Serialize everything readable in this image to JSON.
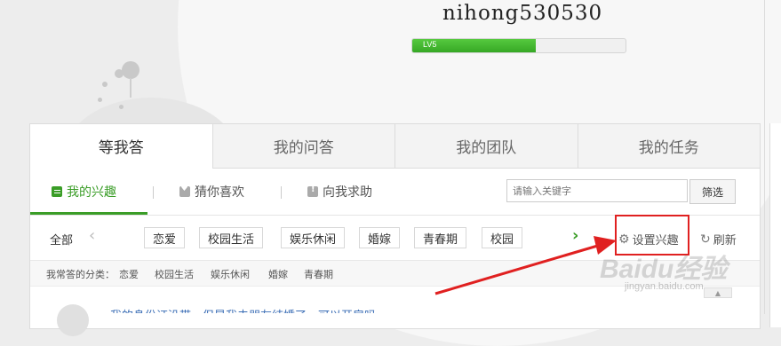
{
  "header": {
    "username": "nihong530530",
    "level_label": "LV5",
    "level_progress": 0.58
  },
  "main_tabs": [
    {
      "label": "等我答",
      "active": true
    },
    {
      "label": "我的问答",
      "active": false
    },
    {
      "label": "我的团队",
      "active": false
    },
    {
      "label": "我的任务",
      "active": false
    }
  ],
  "subnav": {
    "items": [
      {
        "label": "我的兴趣",
        "icon": "list-icon",
        "active": true
      },
      {
        "label": "猜你喜欢",
        "icon": "heart-icon",
        "active": false
      },
      {
        "label": "向我求助",
        "icon": "help-icon",
        "active": false
      }
    ],
    "search_placeholder": "请输入关键字",
    "filter_label": "筛选"
  },
  "tagrow": {
    "all_label": "全部",
    "tags": [
      "恋爱",
      "校园生活",
      "娱乐休闲",
      "婚嫁",
      "青春期",
      "校园"
    ],
    "settings_label": "设置兴趣",
    "refresh_label": "刷新"
  },
  "common": {
    "label": "我常答的分类：",
    "items": [
      "恋爱",
      "校园生活",
      "娱乐休闲",
      "婚嫁",
      "青春期"
    ]
  },
  "question_preview": "我的身份证没带，但是我去朋友结婚了，可以开房吗",
  "watermark": {
    "brand": "Baidu经验",
    "url": "jingyan.baidu.com"
  },
  "colors": {
    "accent_green": "#3a9d27",
    "highlight_red": "#e02020"
  }
}
